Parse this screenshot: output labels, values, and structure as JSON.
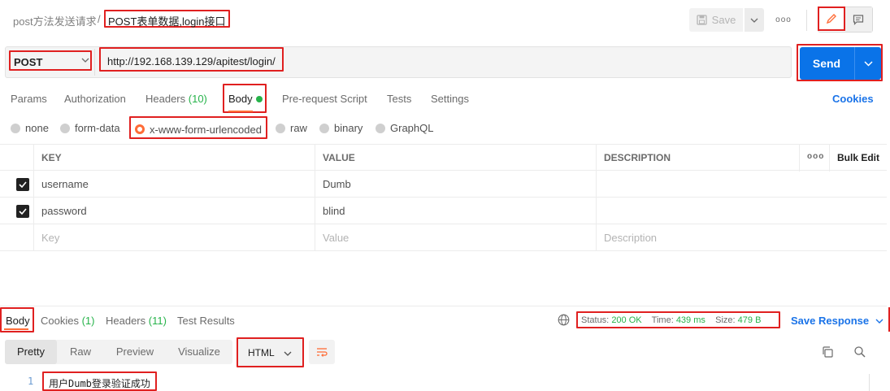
{
  "header": {
    "breadcrumb_parent": "post方法发送请求",
    "breadcrumb_sep": "/",
    "breadcrumb_current": "POST表单数据,login接口",
    "save_label": "Save",
    "more_label": "ooo"
  },
  "request": {
    "method": "POST",
    "url": "http://192.168.139.129/apitest/login/",
    "send_label": "Send"
  },
  "request_tabs": {
    "params": "Params",
    "authorization": "Authorization",
    "headers": "Headers",
    "headers_count": "(10)",
    "body": "Body",
    "pre_request": "Pre-request Script",
    "tests": "Tests",
    "settings": "Settings",
    "cookies": "Cookies"
  },
  "body_types": {
    "none": "none",
    "form_data": "form-data",
    "urlencoded": "x-www-form-urlencoded",
    "raw": "raw",
    "binary": "binary",
    "graphql": "GraphQL",
    "selected": "x-www-form-urlencoded"
  },
  "table": {
    "headers": {
      "key": "KEY",
      "value": "VALUE",
      "description": "DESCRIPTION",
      "more": "ooo",
      "bulk_edit": "Bulk Edit"
    },
    "rows": [
      {
        "key": "username",
        "value": "Dumb",
        "description": "",
        "checked": true
      },
      {
        "key": "password",
        "value": "blind",
        "description": "",
        "checked": true
      }
    ],
    "placeholder": {
      "key": "Key",
      "value": "Value",
      "description": "Description"
    }
  },
  "response": {
    "tabs": {
      "body": "Body",
      "cookies": "Cookies",
      "cookies_count": "(1)",
      "headers": "Headers",
      "headers_count": "(11)",
      "test_results": "Test Results"
    },
    "status_label": "Status:",
    "status_value": "200 OK",
    "time_label": "Time:",
    "time_value": "439 ms",
    "size_label": "Size:",
    "size_value": "479 B",
    "save_response": "Save Response",
    "view_tabs": {
      "pretty": "Pretty",
      "raw": "Raw",
      "preview": "Preview",
      "visualize": "Visualize"
    },
    "format": "HTML",
    "line_number": "1",
    "body_line": "用户Dumb登录验证成功"
  },
  "colors": {
    "accent": "#ff6c37",
    "send": "#0a73e8",
    "link": "#1a73e8",
    "success": "#26b34a",
    "highlight": "#e02020"
  }
}
